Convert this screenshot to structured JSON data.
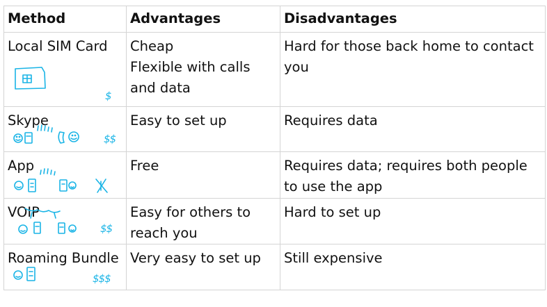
{
  "headers": {
    "method": "Method",
    "advantages": "Advantages",
    "disadvantages": "Disadvantages"
  },
  "rows": [
    {
      "method": "Local SIM Card",
      "advantages": "Cheap\nFlexible with calls\nand data",
      "disadvantages": "Hard for those back home to contact\nyou",
      "price": "$"
    },
    {
      "method": "Skype",
      "advantages": "Easy to set up",
      "disadvantages": "Requires data",
      "price": "$$"
    },
    {
      "method": "App",
      "advantages": "Free",
      "disadvantages": "Requires data; requires both people\nto use the app",
      "price": "$"
    },
    {
      "method": "VOIP",
      "advantages": "Easy for others to\nreach you",
      "disadvantages": "Hard to set up",
      "price": "$$"
    },
    {
      "method": "Roaming Bundle",
      "advantages": "Very easy to set up",
      "disadvantages": "Still expensive",
      "price": "$$$"
    }
  ],
  "sketch_color": "#19b4e6",
  "icons": [
    "sim-card-icon",
    "smiley-face-icon",
    "phone-icon",
    "signal-waves-icon"
  ]
}
